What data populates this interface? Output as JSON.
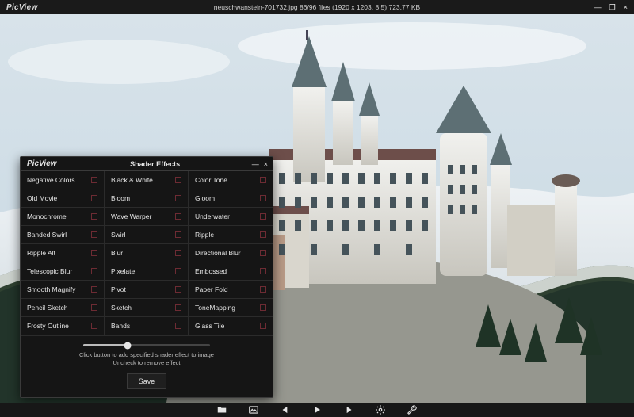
{
  "app": {
    "brand": "PicView"
  },
  "titlebar": {
    "title": "neuschwanstein-701732.jpg 86/96 files (1920 x 1203, 8:5) 723.77 KB"
  },
  "window_controls": {
    "minimize": "—",
    "restore": "❐",
    "close": "×"
  },
  "bottombar": {
    "open": "Open file",
    "gallery": "Gallery",
    "prev": "Previous",
    "play": "Slideshow",
    "next": "Next",
    "settings": "Settings",
    "tools": "Tools"
  },
  "panel": {
    "brand": "PicView",
    "title": "Shader Effects",
    "minimize": "—",
    "close": "×",
    "effects": [
      "Negative Colors",
      "Black & White",
      "Color Tone",
      "Old Movie",
      "Bloom",
      "Gloom",
      "Monochrome",
      "Wave Warper",
      "Underwater",
      "Banded Swirl",
      "Swirl",
      "Ripple",
      "Ripple Alt",
      "Blur",
      "Directional Blur",
      "Telescopic Blur",
      "Pixelate",
      "Embossed",
      "Smooth Magnify",
      "Pivot",
      "Paper Fold",
      "Pencil Sketch",
      "Sketch",
      "ToneMapping",
      "Frosty Outline",
      "Bands",
      "Glass Tile"
    ],
    "help_line1": "Click button to add specified shader effect to image",
    "help_line2": "Uncheck to remove effect",
    "save": "Save"
  }
}
